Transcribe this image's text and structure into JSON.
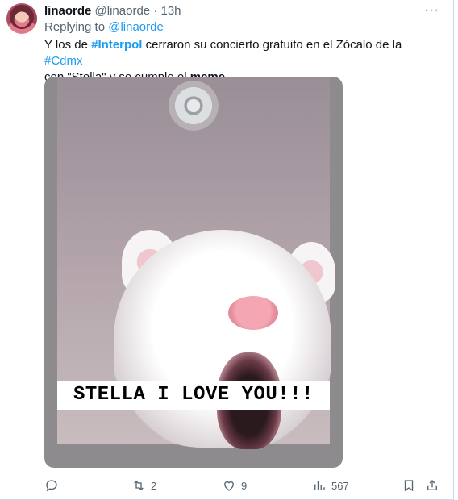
{
  "tweet": {
    "display_name": "linaorde",
    "handle": "@linaorde",
    "separator": "·",
    "time": "13h",
    "more_icon": "more-horizontal-icon",
    "replying_label": "Replying to",
    "replying_handle": "@linaorde",
    "text": {
      "p1": "Y los de ",
      "hashtag1": "#Interpol",
      "p2": " cerraron su concierto gratuito en el Zócalo de la ",
      "hashtag2": "#Cdmx",
      "p3": "con \"Stella\" y se cumple el ",
      "bold": "meme"
    },
    "media": {
      "caption": "STELLA I LOVE YOU!!!"
    },
    "actions": {
      "reply_icon": "reply-icon",
      "retweet_icon": "retweet-icon",
      "retweets": "2",
      "like_icon": "heart-icon",
      "likes": "9",
      "views_icon": "views-chart-icon",
      "views": "567",
      "bookmark_icon": "bookmark-icon",
      "share_icon": "share-icon"
    },
    "colors": {
      "link": "#1d9bf0",
      "muted": "#536471",
      "text": "#0f1419"
    }
  }
}
